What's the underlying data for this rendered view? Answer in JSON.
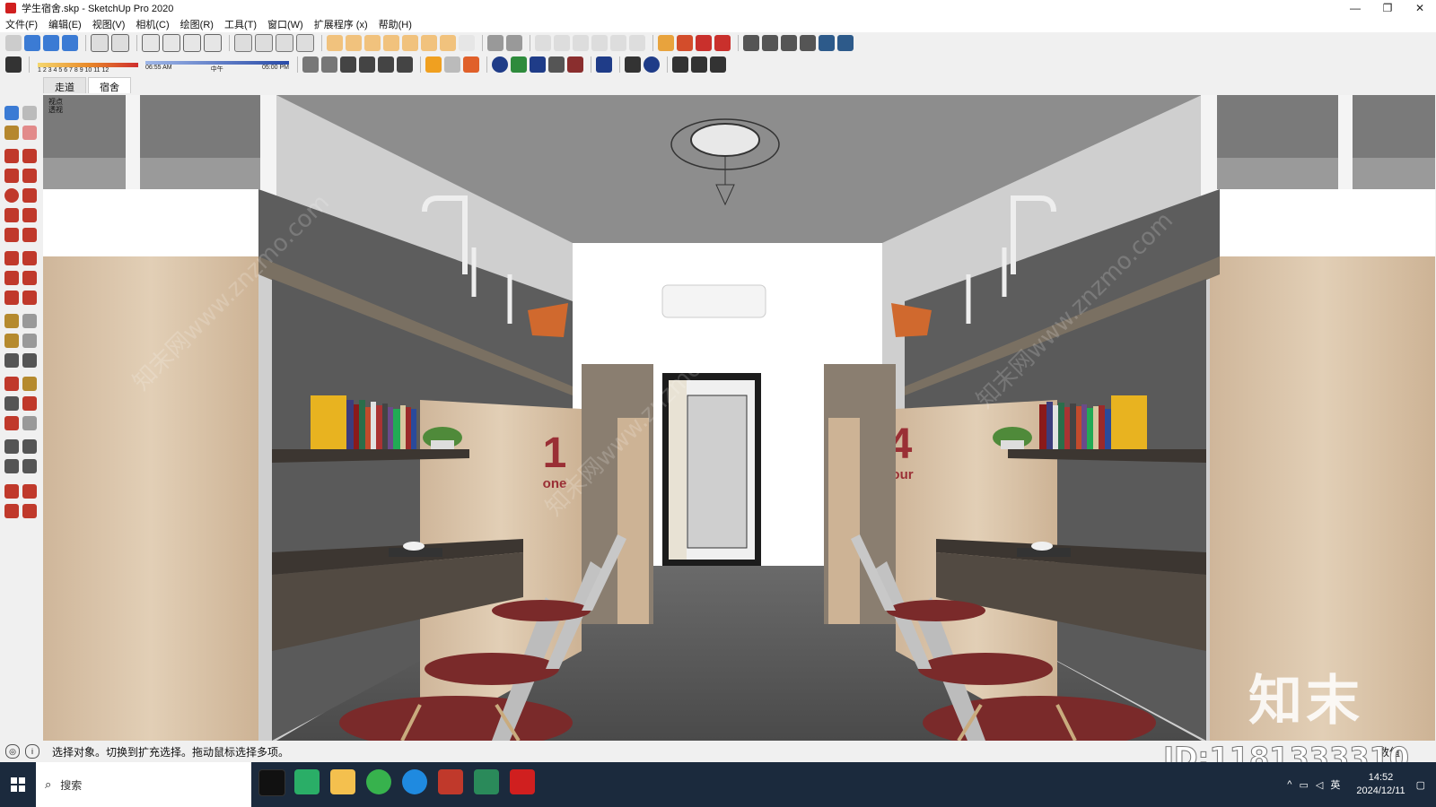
{
  "window": {
    "title": "学生宿舍.skp - SketchUp Pro 2020",
    "controls": [
      "—",
      "❐",
      "✕"
    ]
  },
  "menu": [
    "文件(F)",
    "编辑(E)",
    "视图(V)",
    "相机(C)",
    "绘图(R)",
    "工具(T)",
    "窗口(W)",
    "扩展程序 (x)",
    "帮助(H)"
  ],
  "shadow_settings": {
    "month_ticks": "1 2 3 4 5 6 7 8 9 10 11 12",
    "time_start": "06:55 AM",
    "time_mid": "中午",
    "time_end": "05:00 PM"
  },
  "scene_tabs": [
    {
      "label": "走道",
      "active": false
    },
    {
      "label": "宿舍",
      "active": true
    }
  ],
  "viewport": {
    "overlay_text_1": "视点",
    "overlay_text_2": "透视",
    "bed_number_left": "1",
    "bed_word_left": "one",
    "bed_number_right": "4",
    "bed_word_right": "four"
  },
  "statusbar": {
    "hint": "选择对象。切换到扩充选择。拖动鼠标选择多项。",
    "measure_label": "数值"
  },
  "taskbar": {
    "search_placeholder": "搜索",
    "time": "14:52",
    "date": "2024/12/11",
    "ime": "英"
  },
  "watermark": {
    "logo_text": "知末",
    "id_text": "ID:1181333310",
    "site_text": "知末网www.znzmo.com"
  },
  "colors": {
    "sketchup_red": "#d01f1f",
    "taskbar_bg": "#1b2a3d",
    "wood": "#d8c2a5",
    "dark_grey_wall": "#555555",
    "chair_seat": "#7a2a2a",
    "bed_number_red": "#9a2f35"
  }
}
